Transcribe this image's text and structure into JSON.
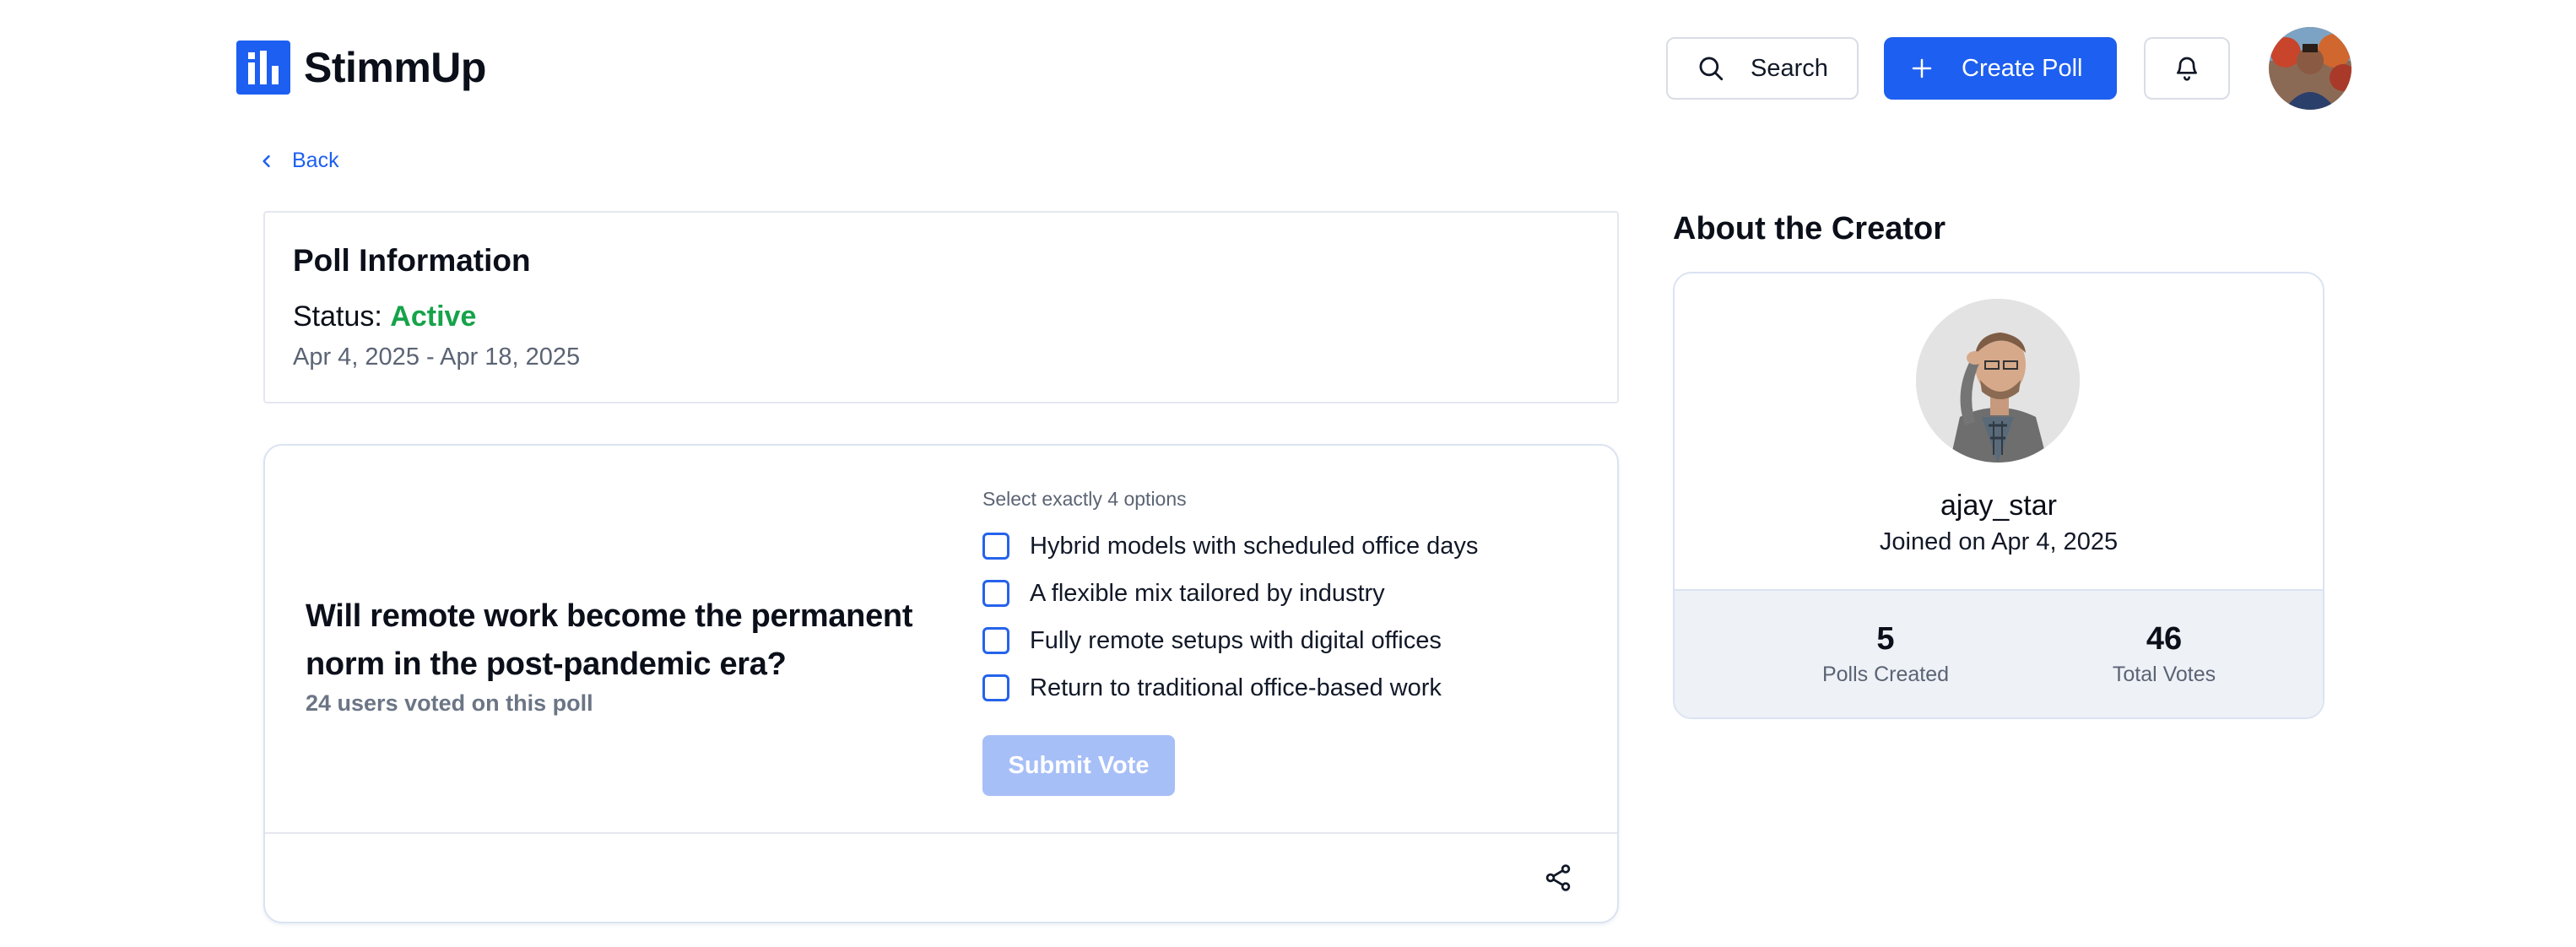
{
  "header": {
    "logo_text": "StimmUp",
    "search_label": "Search",
    "create_label": "Create Poll"
  },
  "nav": {
    "back_label": "Back"
  },
  "poll_info": {
    "title": "Poll Information",
    "status_prefix": "Status:",
    "status_value": "Active",
    "dates": "Apr 4, 2025 - Apr 18, 2025"
  },
  "poll": {
    "question": "Will remote work become the permanent norm in the post-pandemic era?",
    "votes_text": "24 users voted on this poll",
    "hint": "Select exactly 4 options",
    "options": [
      "Hybrid models with scheduled office days",
      "A flexible mix tailored by industry",
      "Fully remote setups with digital offices",
      "Return to traditional office-based work"
    ],
    "submit_label": "Submit Vote"
  },
  "creator": {
    "section_title": "About the Creator",
    "username": "ajay_star",
    "joined": "Joined on Apr 4, 2025",
    "polls_created_value": "5",
    "polls_created_label": "Polls Created",
    "total_votes_value": "46",
    "total_votes_label": "Total Votes"
  },
  "colors": {
    "brand": "#1d5ff0",
    "active": "#16a34a",
    "submit_disabled": "#a7bff7"
  }
}
